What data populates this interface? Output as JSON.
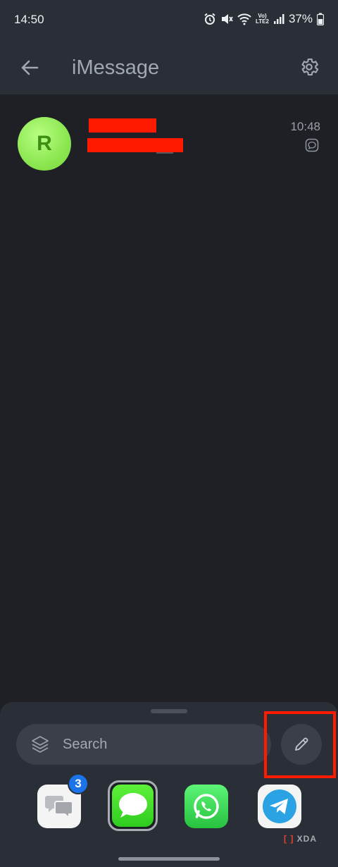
{
  "status_bar": {
    "time": "14:50",
    "network_label_top": "Vo)",
    "network_label_bottom": "LTE2",
    "battery": "37%",
    "icons": [
      "alarm-icon",
      "mute-icon",
      "wifi-icon",
      "signal-icon",
      "battery-icon"
    ]
  },
  "app_bar": {
    "title": "iMessage",
    "back_icon": "back-arrow-icon",
    "settings_icon": "gear-icon"
  },
  "conversations": [
    {
      "avatar_initial": "R",
      "name": "[redacted]",
      "preview": "[redacted]",
      "time": "10:48",
      "type_icon": "chat-bubble-icon"
    }
  ],
  "search": {
    "placeholder": "Search",
    "icon": "layers-icon"
  },
  "compose": {
    "icon": "pencil-icon"
  },
  "dock": [
    {
      "name": "Messages",
      "icon": "messages-app-icon",
      "badge": "3"
    },
    {
      "name": "iMessage",
      "icon": "imessage-app-icon",
      "selected": true
    },
    {
      "name": "WhatsApp",
      "icon": "whatsapp-app-icon"
    },
    {
      "name": "Telegram",
      "icon": "telegram-app-icon"
    }
  ],
  "watermark": {
    "text": "XDA"
  },
  "colors": {
    "background": "#1e2026",
    "bar": "#2a2e37",
    "accent_red": "#ff1a00",
    "badge_blue": "#1a73e8",
    "avatar_green": "#8ce651"
  }
}
